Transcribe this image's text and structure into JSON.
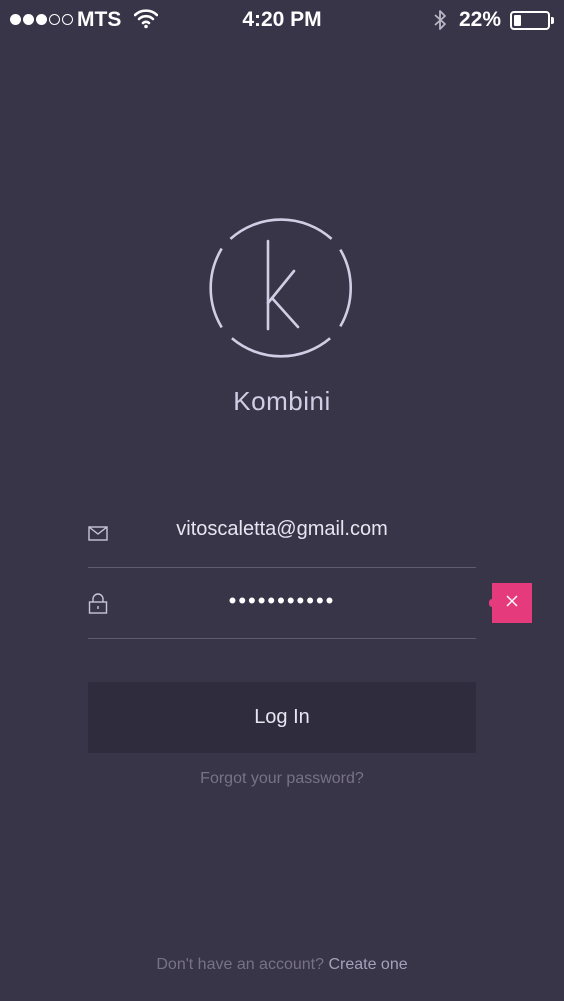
{
  "status_bar": {
    "carrier": "MTS",
    "signal_strength": 3,
    "signal_max": 5,
    "time": "4:20 PM",
    "battery_percent": "22%",
    "battery_level": 0.22
  },
  "brand": {
    "logo_letter": "k",
    "app_name": "Kombini"
  },
  "login_form": {
    "email_value": "vitoscaletta@gmail.com",
    "password_masked": "•••••••••••",
    "login_label": "Log In",
    "forgot_label": "Forgot your password?"
  },
  "footer": {
    "prompt": "Don't have an account?",
    "create_label": "Create one"
  },
  "icons": {
    "email": "envelope-icon",
    "password": "lock-icon",
    "clear": "close-icon",
    "wifi": "wifi-icon",
    "bluetooth": "bluetooth-icon"
  },
  "colors": {
    "background": "#383548",
    "accent": "#e53a7c",
    "button": "#2f2c3d",
    "logo": "#d2cde5"
  }
}
